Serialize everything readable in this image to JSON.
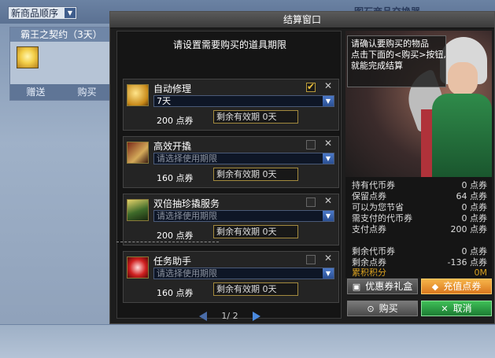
{
  "background": {
    "sort_label": "新商品顺序",
    "card": {
      "title": "霸王之契约（3天）",
      "gift_label": "赠送",
      "buy_label": "购买"
    },
    "right_title": "图石商品交换器"
  },
  "dialog": {
    "title": "结算窗口",
    "instruction": "请设置需要购买的道具期限",
    "items": [
      {
        "name": "自动修理",
        "period": "7天",
        "period_is_placeholder": false,
        "price": "200 点券",
        "remaining": "剩余有效期 0天",
        "checked": true
      },
      {
        "name": "高效开撬",
        "period": "请选择使用期限",
        "period_is_placeholder": true,
        "price": "160 点券",
        "remaining": "剩余有效期 0天",
        "checked": false
      },
      {
        "name": "双倍抽珍撬服务",
        "period": "请选择使用期限",
        "period_is_placeholder": true,
        "price": "200 点券",
        "remaining": "剩余有效期 0天",
        "checked": false
      },
      {
        "name": "任务助手",
        "period": "请选择使用期限",
        "period_is_placeholder": true,
        "price": "160 点券",
        "remaining": "剩余有效期 0天",
        "checked": false
      }
    ],
    "pager": {
      "text": "1/ 2"
    },
    "info_lines": [
      "请确认要购买的物品",
      "点击下面的<购买>按钮,",
      "就能完成结算"
    ],
    "summary": [
      {
        "label": "持有代币券",
        "value": "0 点券"
      },
      {
        "label": "保留点券",
        "value": "64 点券"
      },
      {
        "label": "可以为您节省",
        "value": "0 点券"
      },
      {
        "label": "需支付的代币券",
        "value": "0 点券"
      },
      {
        "label": "支付点券",
        "value": "200 点券"
      },
      {
        "label": "剩余代币券",
        "value": "0 点券"
      },
      {
        "label": "剩余点券",
        "value": "-136 点券"
      },
      {
        "label": "累积积分",
        "value": "0M"
      }
    ],
    "buttons": {
      "coupon": "优惠券礼盒",
      "recharge": "充值点券",
      "buy": "购买",
      "cancel": "取消"
    }
  },
  "colors": {
    "accent_gold": "#d8a020",
    "recharge_orange": "#e8902a",
    "cancel_green": "#2e9e46"
  }
}
